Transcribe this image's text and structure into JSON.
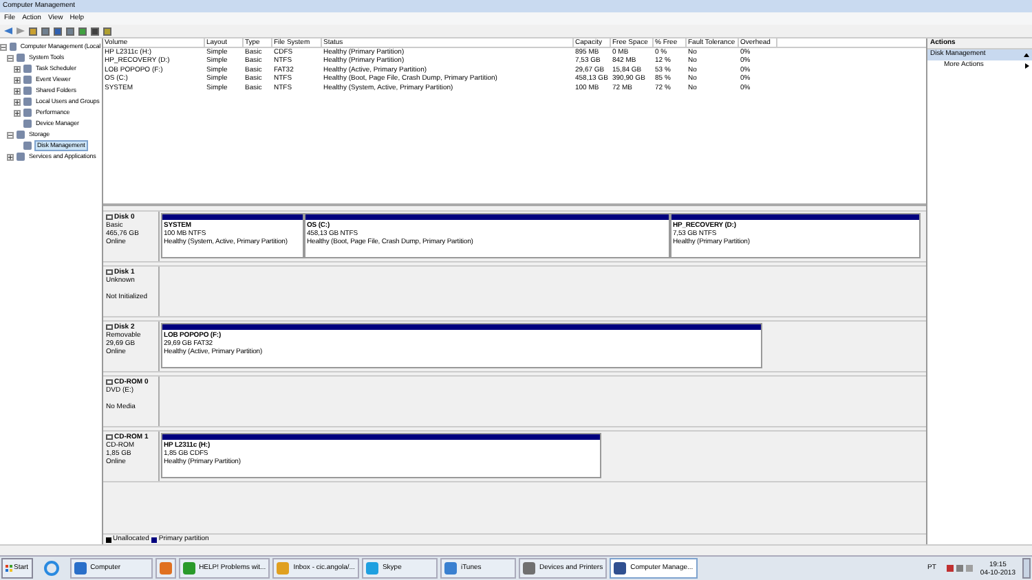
{
  "window": {
    "title": "Computer Management"
  },
  "menu": [
    "File",
    "Action",
    "View",
    "Help"
  ],
  "tree": [
    {
      "label": "Computer Management (Local",
      "expanded": true,
      "selected": false,
      "children": [
        {
          "label": "System Tools",
          "expanded": true,
          "selected": false,
          "children": [
            {
              "label": "Task Scheduler",
              "expanded": false,
              "selected": false
            },
            {
              "label": "Event Viewer",
              "expanded": false,
              "selected": false
            },
            {
              "label": "Shared Folders",
              "expanded": false,
              "selected": false
            },
            {
              "label": "Local Users and Groups",
              "expanded": false,
              "selected": false
            },
            {
              "label": "Performance",
              "expanded": false,
              "selected": false
            },
            {
              "label": "Device Manager",
              "selected": false
            }
          ]
        },
        {
          "label": "Storage",
          "expanded": true,
          "selected": false,
          "children": [
            {
              "label": "Disk Management",
              "selected": true
            }
          ]
        },
        {
          "label": "Services and Applications",
          "expanded": false,
          "selected": false
        }
      ]
    }
  ],
  "table": {
    "columns": [
      "Volume",
      "Layout",
      "Type",
      "File System",
      "Status",
      "Capacity",
      "Free Space",
      "% Free",
      "Fault Tolerance",
      "Overhead"
    ],
    "rows": [
      [
        "HP L2311c (H:)",
        "Simple",
        "Basic",
        "CDFS",
        "Healthy (Primary Partition)",
        "895 MB",
        "0 MB",
        "0 %",
        "No",
        "0%"
      ],
      [
        "HP_RECOVERY (D:)",
        "Simple",
        "Basic",
        "NTFS",
        "Healthy (Primary Partition)",
        "7,53 GB",
        "842 MB",
        "12 %",
        "No",
        "0%"
      ],
      [
        "LOB POPOPO (F:)",
        "Simple",
        "Basic",
        "FAT32",
        "Healthy (Active, Primary Partition)",
        "29,67 GB",
        "15,84 GB",
        "53 %",
        "No",
        "0%"
      ],
      [
        "OS (C:)",
        "Simple",
        "Basic",
        "NTFS",
        "Healthy (Boot, Page File, Crash Dump, Primary Partition)",
        "458,13 GB",
        "390,90 GB",
        "85 %",
        "No",
        "0%"
      ],
      [
        "SYSTEM",
        "Simple",
        "Basic",
        "NTFS",
        "Healthy (System, Active, Primary Partition)",
        "100 MB",
        "72 MB",
        "72 %",
        "No",
        "0%"
      ]
    ]
  },
  "disks": [
    {
      "name": "Disk 0",
      "type": "Basic",
      "size": "465,76 GB",
      "status": "Online",
      "partitions": [
        {
          "name": "SYSTEM",
          "size": "100 MB NTFS",
          "status": "Healthy (System, Active, Primary Partition)"
        },
        {
          "name": "OS  (C:)",
          "size": "458,13 GB NTFS",
          "status": "Healthy (Boot, Page File, Crash Dump, Primary Partition)"
        },
        {
          "name": "HP_RECOVERY  (D:)",
          "size": "7,53 GB NTFS",
          "status": "Healthy (Primary Partition)"
        }
      ]
    },
    {
      "name": "Disk 1",
      "type": "Unknown",
      "status": "Not Initialized"
    },
    {
      "name": "Disk 2",
      "type": "Removable",
      "size": "29,69 GB",
      "status": "Online",
      "partitions": [
        {
          "name": "LOB POPOPO  (F:)",
          "size": "29,69 GB FAT32",
          "status": "Healthy (Active, Primary Partition)"
        }
      ]
    },
    {
      "name": "CD-ROM 0",
      "type": "DVD (E:)",
      "status": "No Media"
    },
    {
      "name": "CD-ROM 1",
      "type": "CD-ROM",
      "size": "1,85 GB",
      "status": "Online",
      "partitions": [
        {
          "name": "HP L2311c  (H:)",
          "size": "1,85 GB CDFS",
          "status": "Healthy (Primary Partition)"
        }
      ]
    }
  ],
  "legend": [
    {
      "label": "Unallocated",
      "color": "#000000"
    },
    {
      "label": "Primary partition",
      "color": "#00007f"
    }
  ],
  "actions": {
    "title": "Actions",
    "section": "Disk Management",
    "items": [
      "More Actions"
    ]
  },
  "taskbar": {
    "start": "Start",
    "items": [
      {
        "label": "Computer",
        "selected": false
      },
      {
        "selected": false
      },
      {
        "label": "HELP! Problems wit...",
        "selected": false
      },
      {
        "label": "Inbox - cic.angola/...",
        "selected": false
      },
      {
        "label": "Skype",
        "selected": false
      },
      {
        "label": "iTunes",
        "selected": false
      },
      {
        "label": "Devices and Printers",
        "selected": false
      },
      {
        "label": "Computer Manage...",
        "selected": true
      }
    ],
    "language": "PT",
    "time": "19:15",
    "date": "04-10-2013"
  }
}
